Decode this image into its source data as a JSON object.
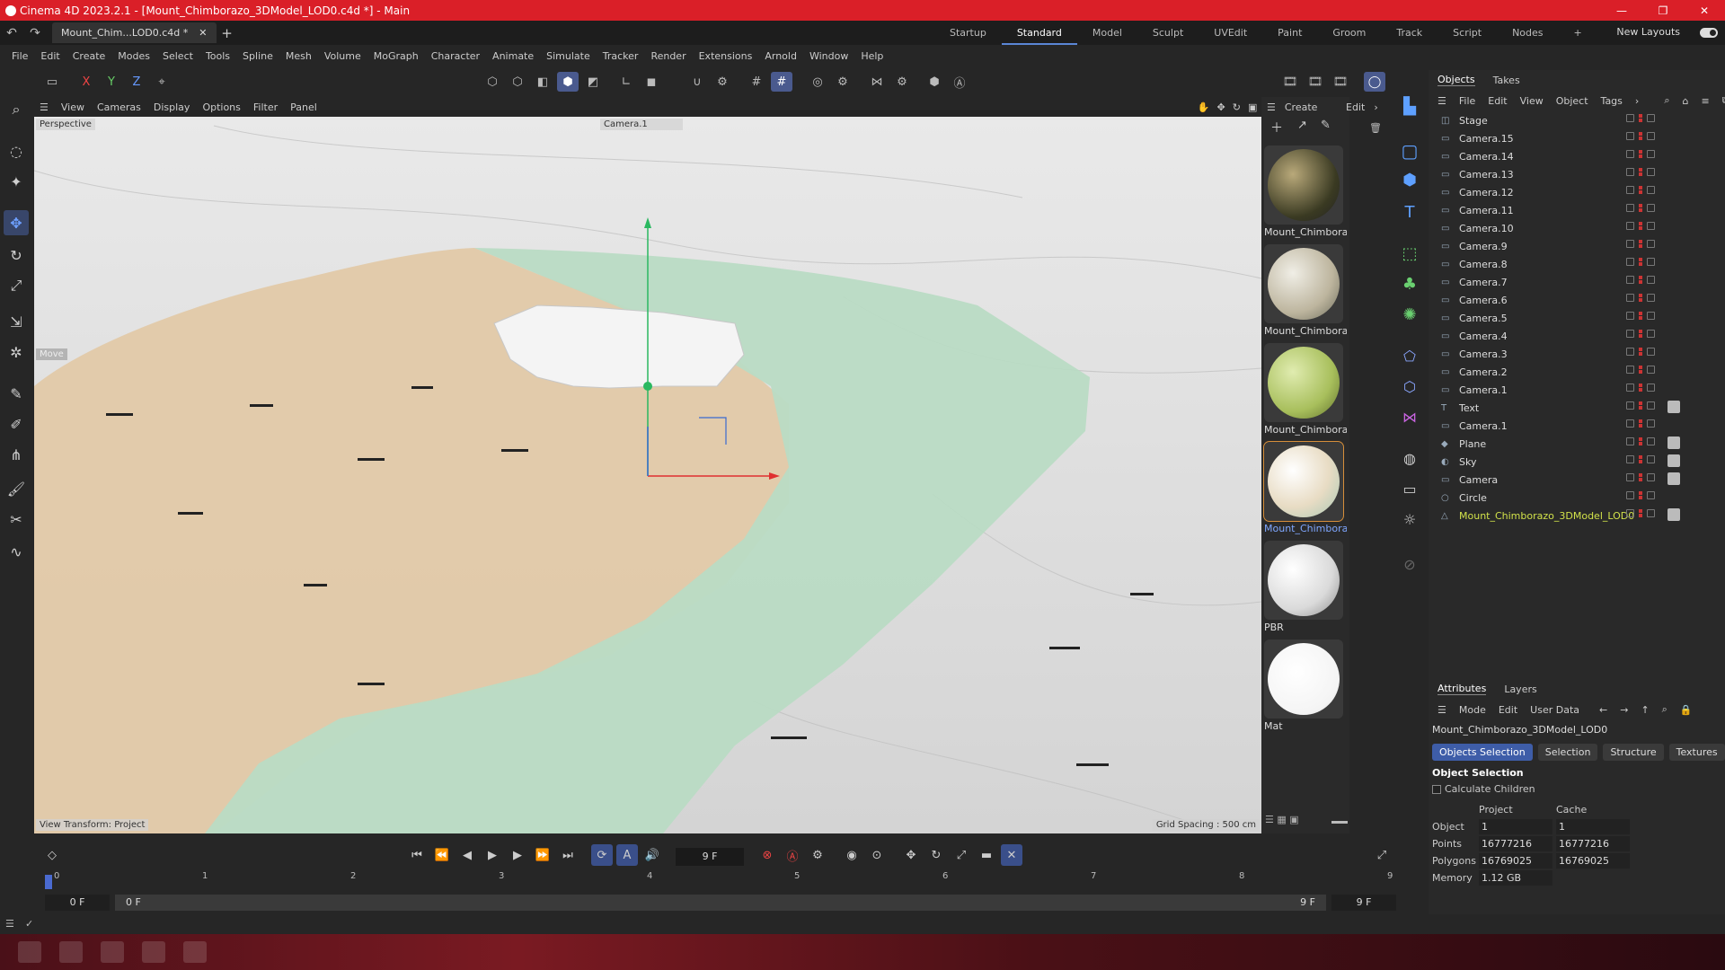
{
  "window": {
    "title": "Cinema 4D 2023.2.1 - [Mount_Chimborazo_3DModel_LOD0.c4d *] - Main",
    "min": "—",
    "max": "❐",
    "close": "✕"
  },
  "doc_tab": {
    "label": "Mount_Chim...LOD0.c4d *",
    "close": "✕"
  },
  "layouts": [
    "Startup",
    "Standard",
    "Model",
    "Sculpt",
    "UVEdit",
    "Paint",
    "Groom",
    "Track",
    "Script",
    "Nodes"
  ],
  "active_layout": "Standard",
  "new_layouts": "New Layouts",
  "menu": [
    "File",
    "Edit",
    "Create",
    "Modes",
    "Select",
    "Tools",
    "Spline",
    "Mesh",
    "Volume",
    "MoGraph",
    "Character",
    "Animate",
    "Simulate",
    "Tracker",
    "Render",
    "Extensions",
    "Arnold",
    "Window",
    "Help"
  ],
  "axis_buttons": [
    "X",
    "Y",
    "Z"
  ],
  "viewport_menu": [
    "View",
    "Cameras",
    "Display",
    "Options",
    "Filter",
    "Panel"
  ],
  "viewport": {
    "label": "Perspective",
    "camera": "Camera.1",
    "move_tag": "Move",
    "view_transform": "View Transform: Project",
    "grid_spacing": "Grid Spacing : 500 cm"
  },
  "materials_menu": [
    "Create",
    "Edit"
  ],
  "materials": [
    {
      "name": "Mount_Chimbora:",
      "color": "#5a5a3a"
    },
    {
      "name": "Mount_Chimbora:",
      "color": "#c9c4b4"
    },
    {
      "name": "Mount_Chimbora:",
      "color": "#b9c87a"
    },
    {
      "name": "Mount_Chimbora:",
      "color": "#e8e8e0"
    },
    {
      "name": "PBR",
      "color": "#e6e6e6"
    },
    {
      "name": "Mat",
      "color": "#ffffff"
    }
  ],
  "objects_tabs": [
    "Objects",
    "Takes"
  ],
  "objects_menu": [
    "File",
    "Edit",
    "View",
    "Object",
    "Tags"
  ],
  "objects": [
    {
      "name": "Stage",
      "icon": "stage-icon"
    },
    {
      "name": "Camera.15",
      "icon": "camera-icon"
    },
    {
      "name": "Camera.14",
      "icon": "camera-icon"
    },
    {
      "name": "Camera.13",
      "icon": "camera-icon"
    },
    {
      "name": "Camera.12",
      "icon": "camera-icon"
    },
    {
      "name": "Camera.11",
      "icon": "camera-icon"
    },
    {
      "name": "Camera.10",
      "icon": "camera-icon"
    },
    {
      "name": "Camera.9",
      "icon": "camera-icon"
    },
    {
      "name": "Camera.8",
      "icon": "camera-icon"
    },
    {
      "name": "Camera.7",
      "icon": "camera-icon"
    },
    {
      "name": "Camera.6",
      "icon": "camera-icon"
    },
    {
      "name": "Camera.5",
      "icon": "camera-icon"
    },
    {
      "name": "Camera.4",
      "icon": "camera-icon"
    },
    {
      "name": "Camera.3",
      "icon": "camera-icon"
    },
    {
      "name": "Camera.2",
      "icon": "camera-icon"
    },
    {
      "name": "Camera.1",
      "icon": "camera-icon"
    },
    {
      "name": "Text",
      "icon": "text-icon"
    },
    {
      "name": "Camera.1",
      "icon": "camera-icon"
    },
    {
      "name": "Plane",
      "icon": "plane-icon"
    },
    {
      "name": "Sky",
      "icon": "sky-icon"
    },
    {
      "name": "Camera",
      "icon": "camera-icon"
    },
    {
      "name": "Circle",
      "icon": "circle-icon"
    },
    {
      "name": "Mount_Chimborazo_3DModel_LOD0",
      "icon": "polygon-object-icon"
    }
  ],
  "attributes": {
    "tabs": [
      "Attributes",
      "Layers"
    ],
    "menu": [
      "Mode",
      "Edit",
      "User Data"
    ],
    "object_name": "Mount_Chimborazo_3DModel_LOD0",
    "subtabs": [
      "Objects Selection",
      "Selection",
      "Structure",
      "Textures"
    ],
    "section": "Object Selection",
    "checkbox": "Calculate Children",
    "col_project": "Project",
    "col_cache": "Cache",
    "rows": [
      {
        "k": "Object",
        "p": "1",
        "c": "1"
      },
      {
        "k": "Points",
        "p": "16777216",
        "c": "16777216"
      },
      {
        "k": "Polygons",
        "p": "16769025",
        "c": "16769025"
      },
      {
        "k": "Memory",
        "p": "1.12 GB",
        "c": ""
      }
    ]
  },
  "timeline": {
    "current_frame": "9 F",
    "ticks": [
      "0",
      "1",
      "2",
      "3",
      "4",
      "5",
      "6",
      "7",
      "8",
      "9"
    ],
    "start": "0 F",
    "start2": "0 F",
    "end": "9 F",
    "end2": "9 F"
  },
  "colors": {
    "accent": "#da1f28",
    "selection": "#5a86d6",
    "tan_zone": "#e2c9a8",
    "green_zone": "#b9dbc4"
  }
}
